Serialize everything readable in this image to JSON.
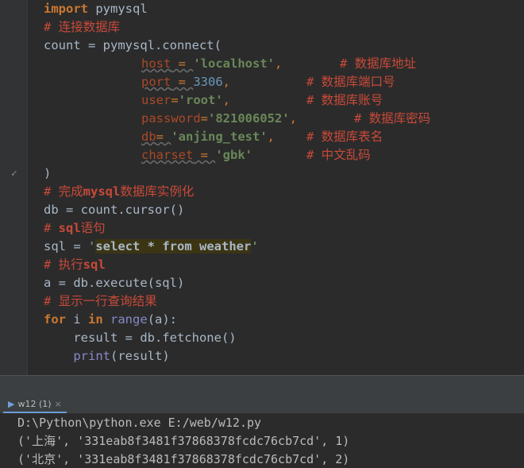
{
  "code": {
    "l1_kw": "import",
    "l1_mod": " pymysql",
    "l2_cmt": "# 连接数据库",
    "l3_a": "count = pymysql.connect(",
    "l4_param": "host",
    "l4_eq": " = ",
    "l4_str": "'localhost'",
    "l4_comma": ",",
    "l4_cmt": "# 数据库地址",
    "l5_param": "port",
    "l5_eq": " = ",
    "l5_num": "3306",
    "l5_comma": ",",
    "l5_cmt": "# 数据库端口号",
    "l6_param": "user",
    "l6_eq": "=",
    "l6_str": "'root'",
    "l6_comma": ",",
    "l6_cmt": "# 数据库账号",
    "l7_param": "password",
    "l7_eq": "=",
    "l7_str": "'821006052'",
    "l7_comma": ",",
    "l7_cmt": "# 数据库密码",
    "l8_param": "db",
    "l8_eq": "= ",
    "l8_str": "'anjing_test'",
    "l8_comma": ",",
    "l8_cmt": "# 数据库表名",
    "l9_param": "charset",
    "l9_eq": " = ",
    "l9_str": "'gbk'",
    "l9_cmt": "# 中文乱码",
    "l10": ")",
    "l11_a": "# 完成",
    "l11_b": "mysql",
    "l11_c": "数据库实例化",
    "l12": "db = count.cursor()",
    "l13_a": "# ",
    "l13_b": "sql",
    "l13_c": "语句",
    "l14_a": "sql = ",
    "l14_q1": "'",
    "l14_hl": "select * from weather",
    "l14_q2": "'",
    "l15_a": "# 执行",
    "l15_b": "sql",
    "l16": "a = db.execute(sql)",
    "l17": "# 显示一行查询结果",
    "l18_for": "for",
    "l18_i": " i ",
    "l18_in": "in",
    "l18_sp": " ",
    "l18_range": "range",
    "l18_rest": "(a):",
    "l19": "    result = db.fetchone()",
    "l20_sp": "    ",
    "l20_print": "print",
    "l20_rest": "(result)"
  },
  "fold_mark": "✓",
  "run_tab": {
    "label": "w12 (1)",
    "close": "×"
  },
  "console": {
    "line1": "D:\\Python\\python.exe E:/web/w12.py",
    "line2_a": "('",
    "line2_city": "上海",
    "line2_b": "', '331eab8f3481f37868378fcdc76cb7cd', 1)",
    "line3_a": "('",
    "line3_city": "北京",
    "line3_b": "', '331eab8f3481f37868378fcdc76cb7cd', 2)"
  }
}
